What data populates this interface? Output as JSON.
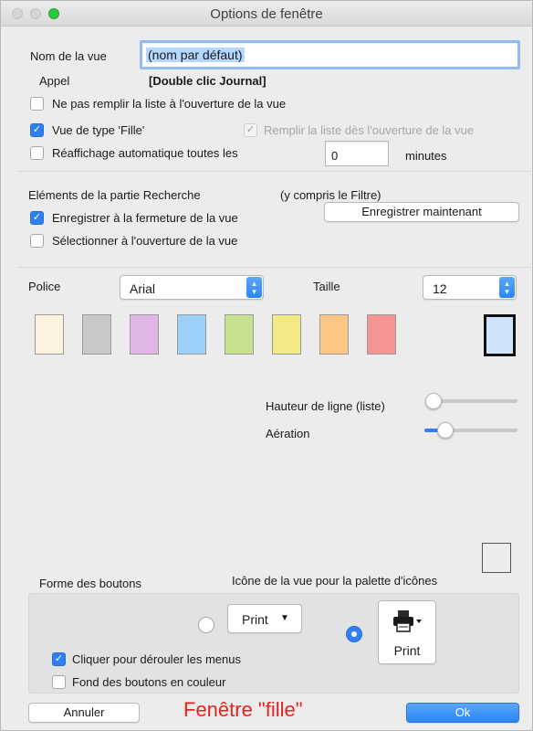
{
  "window": {
    "title": "Options de fenêtre"
  },
  "vue": {
    "name_label": "Nom de la vue",
    "name_value": "(nom par défaut)",
    "appel_label": "Appel",
    "appel_value": "[Double clic Journal]"
  },
  "options": {
    "no_fill": {
      "label": "Ne pas remplir la liste à l'ouverture de la vue",
      "checked": false
    },
    "fille": {
      "label": "Vue de type 'Fille'",
      "checked": true
    },
    "fill_open": {
      "label": "Remplir la liste dès l'ouverture de la vue",
      "checked": true,
      "disabled": true
    },
    "refresh": {
      "label": "Réaffichage automatique toutes les",
      "checked": false,
      "value": "0",
      "unit": "minutes"
    }
  },
  "recherche": {
    "title": "Eléments de la partie Recherche",
    "note": "(y compris le Filtre)",
    "save_now": "Enregistrer maintenant",
    "save_close": {
      "label": "Enregistrer à la fermeture de la vue",
      "checked": true
    },
    "select_open": {
      "label": "Sélectionner à l'ouverture de la vue",
      "checked": false
    }
  },
  "font": {
    "police_label": "Police",
    "police_value": "Arial",
    "taille_label": "Taille",
    "taille_value": "12"
  },
  "swatches": [
    "#fdf1e0",
    "#c8c8c8",
    "#e0b5e6",
    "#9dd0f8",
    "#c6e28f",
    "#f3ea85",
    "#fcc684",
    "#f59593"
  ],
  "selected_swatch": "#cfe3fb",
  "sliders": {
    "hauteur": {
      "label": "Hauteur de ligne (liste)",
      "value": 0
    },
    "aeration": {
      "label": "Aération",
      "value": 0.25
    }
  },
  "icone_label": "Icône de la vue pour la palette d'icônes",
  "boutons": {
    "title": "Forme des boutons",
    "option_a_label": "Print",
    "option_b_label": "Print",
    "menus": {
      "label": "Cliquer pour dérouler les menus",
      "checked": true
    },
    "couleur": {
      "label": "Fond des boutons en couleur",
      "checked": false
    }
  },
  "footer": {
    "cancel": "Annuler",
    "caption": "Fenêtre \"fille\"",
    "ok": "Ok"
  },
  "colors": {
    "accent": "#2f7ff1",
    "caption": "#e82121"
  }
}
